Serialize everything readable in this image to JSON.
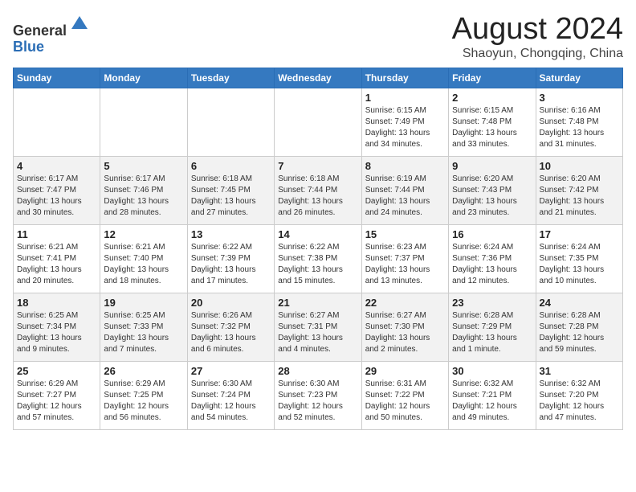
{
  "header": {
    "logo_line1": "General",
    "logo_line2": "Blue",
    "month": "August 2024",
    "location": "Shaoyun, Chongqing, China"
  },
  "weekdays": [
    "Sunday",
    "Monday",
    "Tuesday",
    "Wednesday",
    "Thursday",
    "Friday",
    "Saturday"
  ],
  "weeks": [
    [
      {
        "day": "",
        "info": ""
      },
      {
        "day": "",
        "info": ""
      },
      {
        "day": "",
        "info": ""
      },
      {
        "day": "",
        "info": ""
      },
      {
        "day": "1",
        "info": "Sunrise: 6:15 AM\nSunset: 7:49 PM\nDaylight: 13 hours\nand 34 minutes."
      },
      {
        "day": "2",
        "info": "Sunrise: 6:15 AM\nSunset: 7:48 PM\nDaylight: 13 hours\nand 33 minutes."
      },
      {
        "day": "3",
        "info": "Sunrise: 6:16 AM\nSunset: 7:48 PM\nDaylight: 13 hours\nand 31 minutes."
      }
    ],
    [
      {
        "day": "4",
        "info": "Sunrise: 6:17 AM\nSunset: 7:47 PM\nDaylight: 13 hours\nand 30 minutes."
      },
      {
        "day": "5",
        "info": "Sunrise: 6:17 AM\nSunset: 7:46 PM\nDaylight: 13 hours\nand 28 minutes."
      },
      {
        "day": "6",
        "info": "Sunrise: 6:18 AM\nSunset: 7:45 PM\nDaylight: 13 hours\nand 27 minutes."
      },
      {
        "day": "7",
        "info": "Sunrise: 6:18 AM\nSunset: 7:44 PM\nDaylight: 13 hours\nand 26 minutes."
      },
      {
        "day": "8",
        "info": "Sunrise: 6:19 AM\nSunset: 7:44 PM\nDaylight: 13 hours\nand 24 minutes."
      },
      {
        "day": "9",
        "info": "Sunrise: 6:20 AM\nSunset: 7:43 PM\nDaylight: 13 hours\nand 23 minutes."
      },
      {
        "day": "10",
        "info": "Sunrise: 6:20 AM\nSunset: 7:42 PM\nDaylight: 13 hours\nand 21 minutes."
      }
    ],
    [
      {
        "day": "11",
        "info": "Sunrise: 6:21 AM\nSunset: 7:41 PM\nDaylight: 13 hours\nand 20 minutes."
      },
      {
        "day": "12",
        "info": "Sunrise: 6:21 AM\nSunset: 7:40 PM\nDaylight: 13 hours\nand 18 minutes."
      },
      {
        "day": "13",
        "info": "Sunrise: 6:22 AM\nSunset: 7:39 PM\nDaylight: 13 hours\nand 17 minutes."
      },
      {
        "day": "14",
        "info": "Sunrise: 6:22 AM\nSunset: 7:38 PM\nDaylight: 13 hours\nand 15 minutes."
      },
      {
        "day": "15",
        "info": "Sunrise: 6:23 AM\nSunset: 7:37 PM\nDaylight: 13 hours\nand 13 minutes."
      },
      {
        "day": "16",
        "info": "Sunrise: 6:24 AM\nSunset: 7:36 PM\nDaylight: 13 hours\nand 12 minutes."
      },
      {
        "day": "17",
        "info": "Sunrise: 6:24 AM\nSunset: 7:35 PM\nDaylight: 13 hours\nand 10 minutes."
      }
    ],
    [
      {
        "day": "18",
        "info": "Sunrise: 6:25 AM\nSunset: 7:34 PM\nDaylight: 13 hours\nand 9 minutes."
      },
      {
        "day": "19",
        "info": "Sunrise: 6:25 AM\nSunset: 7:33 PM\nDaylight: 13 hours\nand 7 minutes."
      },
      {
        "day": "20",
        "info": "Sunrise: 6:26 AM\nSunset: 7:32 PM\nDaylight: 13 hours\nand 6 minutes."
      },
      {
        "day": "21",
        "info": "Sunrise: 6:27 AM\nSunset: 7:31 PM\nDaylight: 13 hours\nand 4 minutes."
      },
      {
        "day": "22",
        "info": "Sunrise: 6:27 AM\nSunset: 7:30 PM\nDaylight: 13 hours\nand 2 minutes."
      },
      {
        "day": "23",
        "info": "Sunrise: 6:28 AM\nSunset: 7:29 PM\nDaylight: 13 hours\nand 1 minute."
      },
      {
        "day": "24",
        "info": "Sunrise: 6:28 AM\nSunset: 7:28 PM\nDaylight: 12 hours\nand 59 minutes."
      }
    ],
    [
      {
        "day": "25",
        "info": "Sunrise: 6:29 AM\nSunset: 7:27 PM\nDaylight: 12 hours\nand 57 minutes."
      },
      {
        "day": "26",
        "info": "Sunrise: 6:29 AM\nSunset: 7:25 PM\nDaylight: 12 hours\nand 56 minutes."
      },
      {
        "day": "27",
        "info": "Sunrise: 6:30 AM\nSunset: 7:24 PM\nDaylight: 12 hours\nand 54 minutes."
      },
      {
        "day": "28",
        "info": "Sunrise: 6:30 AM\nSunset: 7:23 PM\nDaylight: 12 hours\nand 52 minutes."
      },
      {
        "day": "29",
        "info": "Sunrise: 6:31 AM\nSunset: 7:22 PM\nDaylight: 12 hours\nand 50 minutes."
      },
      {
        "day": "30",
        "info": "Sunrise: 6:32 AM\nSunset: 7:21 PM\nDaylight: 12 hours\nand 49 minutes."
      },
      {
        "day": "31",
        "info": "Sunrise: 6:32 AM\nSunset: 7:20 PM\nDaylight: 12 hours\nand 47 minutes."
      }
    ]
  ]
}
